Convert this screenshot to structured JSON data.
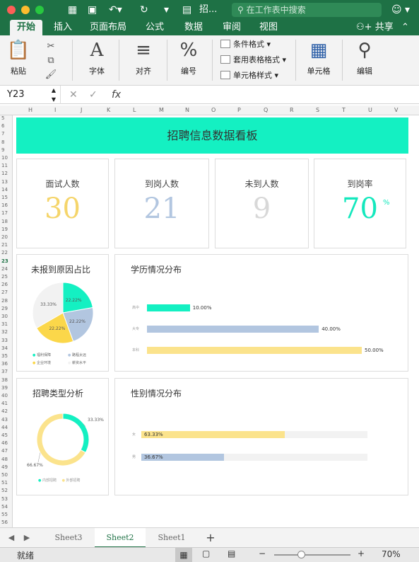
{
  "titlebar": {
    "doc_title": "招...",
    "search_placeholder": "在工作表中搜索"
  },
  "ribbon_tabs": [
    "开始",
    "插入",
    "页面布局",
    "公式",
    "数据",
    "审阅",
    "视图"
  ],
  "share_label": "共享",
  "ribbon": {
    "paste": "粘贴",
    "font": "字体",
    "align": "对齐",
    "number": "编号",
    "number_glyph": "%",
    "conditional_format": "条件格式",
    "table_format": "套用表格格式",
    "cell_style": "单元格样式",
    "cells": "单元格",
    "edit": "编辑"
  },
  "formula_bar": {
    "cell_ref": "Y23",
    "fx": "fx",
    "content": ""
  },
  "columns": [
    "H",
    "I",
    "J",
    "K",
    "L",
    "M",
    "N",
    "O",
    "P",
    "Q",
    "R",
    "S",
    "T",
    "U",
    "V"
  ],
  "rows": [
    "5",
    "6",
    "7",
    "8",
    "9",
    "10",
    "11",
    "12",
    "13",
    "14",
    "15",
    "16",
    "17",
    "18",
    "19",
    "20",
    "21",
    "22",
    "23",
    "24",
    "25",
    "26",
    "27",
    "28",
    "29",
    "30",
    "31",
    "32",
    "33",
    "34",
    "35",
    "36",
    "37",
    "38",
    "39",
    "40",
    "41",
    "42",
    "43",
    "44",
    "45",
    "46",
    "47",
    "48",
    "49",
    "50",
    "51",
    "52",
    "53",
    "54",
    "55",
    "56"
  ],
  "dashboard": {
    "title": "招聘信息数据看板",
    "kpis": [
      {
        "label": "面试人数",
        "value": "30",
        "color": "#f5d56b"
      },
      {
        "label": "到岗人数",
        "value": "21",
        "color": "#b2c6e0"
      },
      {
        "label": "未到人数",
        "value": "9",
        "color": "#d8d8d8"
      },
      {
        "label": "到岗率",
        "value": "70",
        "unit": "%",
        "color": "#14e8bd"
      }
    ],
    "reason_title": "未报到原因占比",
    "reason_legend": [
      "福利保障",
      "路程太远",
      "企业环境",
      "薪资水平"
    ],
    "education_title": "学历情况分布",
    "recruit_title": "招聘类型分析",
    "recruit_legend": [
      "内部招聘",
      "外部招聘"
    ],
    "gender_title": "性别情况分布"
  },
  "chart_data": [
    {
      "type": "pie",
      "title": "未报到原因占比",
      "categories": [
        "福利保障",
        "路程太远",
        "企业环境",
        "薪资水平"
      ],
      "values": [
        22.22,
        22.22,
        22.22,
        33.33
      ],
      "labels": [
        "22.22%",
        "22.22%",
        "22.22%",
        "33.33%"
      ],
      "colors": [
        "#14f0c2",
        "#b2c6e0",
        "#fbd74a",
        "#f2f2f2"
      ],
      "legend": "bottom"
    },
    {
      "type": "bar",
      "orientation": "horizontal",
      "title": "学历情况分布",
      "categories": [
        "高中",
        "大专",
        "本科"
      ],
      "values": [
        10,
        40,
        50
      ],
      "labels": [
        "10.00%",
        "40.00%",
        "50.00%"
      ],
      "colors": [
        "#14f0c2",
        "#b2c6e0",
        "#fbe38c"
      ],
      "xlim": [
        0,
        50
      ]
    },
    {
      "type": "pie",
      "subtype": "donut",
      "title": "招聘类型分析",
      "categories": [
        "内部招聘",
        "外部招聘"
      ],
      "values": [
        33.33,
        66.67
      ],
      "labels": [
        "33.33%",
        "66.67%"
      ],
      "colors": [
        "#14f0c2",
        "#fbe38c"
      ],
      "legend": "bottom"
    },
    {
      "type": "bar",
      "orientation": "horizontal",
      "title": "性别情况分布",
      "categories": [
        "女",
        "男"
      ],
      "values": [
        63.33,
        36.67
      ],
      "labels": [
        "63.33%",
        "36.67%"
      ],
      "colors": [
        "#fbe38c",
        "#b2c6e0"
      ],
      "xlim": [
        0,
        100
      ]
    }
  ],
  "sheets": [
    "Sheet3",
    "Sheet2",
    "Sheet1"
  ],
  "active_sheet": "Sheet2",
  "status": {
    "ready": "就绪",
    "zoom": "70%",
    "zoom_level": 0.35
  }
}
